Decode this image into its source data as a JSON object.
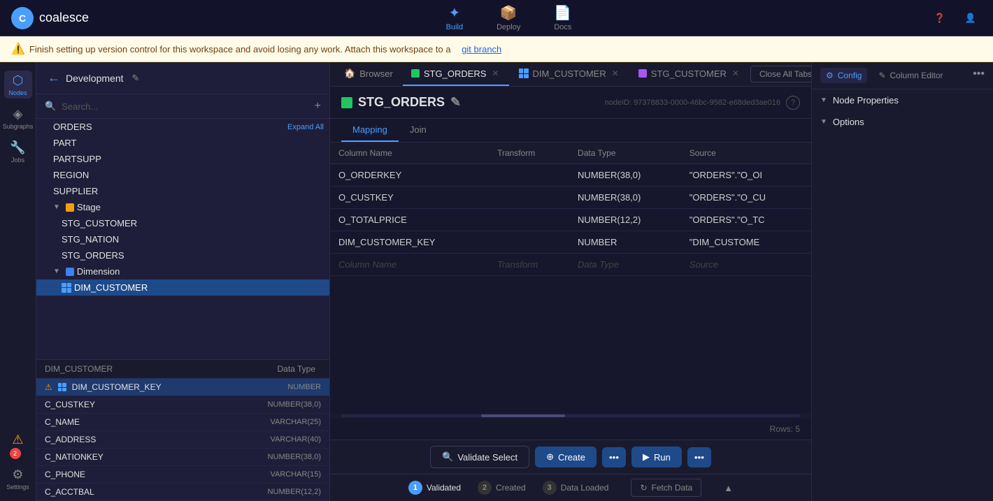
{
  "app": {
    "logo_text": "coalesce",
    "logo_abbr": "C"
  },
  "top_nav": {
    "tabs": [
      {
        "id": "build",
        "label": "Build",
        "icon": "✦",
        "active": true
      },
      {
        "id": "deploy",
        "label": "Deploy",
        "icon": "📦",
        "active": false
      },
      {
        "id": "docs",
        "label": "Docs",
        "icon": "📄",
        "active": false
      }
    ]
  },
  "warning_banner": {
    "text": "Finish setting up version control for this workspace and avoid losing any work. Attach this workspace to a",
    "link_text": "git branch"
  },
  "sidebar": {
    "title": "Development",
    "search_placeholder": "Search...",
    "tree": {
      "root_items": [
        {
          "name": "ORDERS",
          "indent": 2
        },
        {
          "name": "PART",
          "indent": 2
        },
        {
          "name": "PARTSUPP",
          "indent": 2
        },
        {
          "name": "REGION",
          "indent": 2
        },
        {
          "name": "SUPPLIER",
          "indent": 2
        },
        {
          "name": "Stage",
          "indent": 1,
          "folder": true,
          "expanded": true
        },
        {
          "name": "STG_CUSTOMER",
          "indent": 2
        },
        {
          "name": "STG_NATION",
          "indent": 2
        },
        {
          "name": "STG_ORDERS",
          "indent": 2
        },
        {
          "name": "Dimension",
          "indent": 1,
          "folder": true,
          "expanded": true
        },
        {
          "name": "DIM_CUSTOMER",
          "indent": 2,
          "selected": true
        }
      ]
    },
    "bottom_panel": {
      "headers": [
        "DIM_CUSTOMER",
        "Data Type"
      ],
      "rows": [
        {
          "name": "DIM_CUSTOMER_KEY",
          "type": "NUMBER",
          "selected": true,
          "warning": true
        },
        {
          "name": "C_CUSTKEY",
          "type": "NUMBER(38,0)",
          "selected": false
        },
        {
          "name": "C_NAME",
          "type": "VARCHAR(25)",
          "selected": false
        },
        {
          "name": "C_ADDRESS",
          "type": "VARCHAR(40)",
          "selected": false
        },
        {
          "name": "C_NATIONKEY",
          "type": "NUMBER(38,0)",
          "selected": false
        },
        {
          "name": "C_PHONE",
          "type": "VARCHAR(15)",
          "selected": false
        },
        {
          "name": "C_ACCTBAL",
          "type": "NUMBER(12,2)",
          "selected": false
        }
      ],
      "warning_count": "2"
    }
  },
  "icon_nav": {
    "items": [
      {
        "id": "nodes",
        "label": "Nodes",
        "icon": "⬡",
        "active": true
      },
      {
        "id": "subgraphs",
        "label": "Subgraphs",
        "icon": "◈",
        "active": false
      },
      {
        "id": "jobs",
        "label": "Jobs",
        "icon": "🔧",
        "active": false
      },
      {
        "id": "settings",
        "label": "Settings",
        "icon": "⚙",
        "active": false
      }
    ],
    "warning_count": "2"
  },
  "tabs_bar": {
    "tabs": [
      {
        "id": "browser",
        "label": "Browser",
        "icon": "🏠",
        "closable": false,
        "active": false
      },
      {
        "id": "stg_orders",
        "label": "STG_ORDERS",
        "icon": "green",
        "closable": true,
        "active": true
      },
      {
        "id": "dim_customer",
        "label": "DIM_CUSTOMER",
        "icon": "blue",
        "closable": true,
        "active": false
      },
      {
        "id": "stg_customer",
        "label": "STG_CUSTOMER",
        "icon": "purple",
        "closable": true,
        "active": false
      }
    ],
    "close_all_label": "Close All Tabs"
  },
  "node_header": {
    "title": "STG_ORDERS",
    "node_id": "nodeID: 97378833-0000-46bc-9582-e68ded3ae016"
  },
  "sub_tabs": [
    {
      "id": "mapping",
      "label": "Mapping",
      "active": true
    },
    {
      "id": "join",
      "label": "Join",
      "active": false
    }
  ],
  "table": {
    "columns": [
      "Column Name",
      "Transform",
      "Data Type",
      "Source"
    ],
    "rows": [
      {
        "column_name": "O_ORDERKEY",
        "transform": "",
        "data_type": "NUMBER(38,0)",
        "source": "\"ORDERS\".\"O_OI"
      },
      {
        "column_name": "O_CUSTKEY",
        "transform": "",
        "data_type": "NUMBER(38,0)",
        "source": "\"ORDERS\".\"O_CU"
      },
      {
        "column_name": "O_TOTALPRICE",
        "transform": "",
        "data_type": "NUMBER(12,2)",
        "source": "\"ORDERS\".\"O_TC"
      },
      {
        "column_name": "DIM_CUSTOMER_KEY",
        "transform": "",
        "data_type": "NUMBER",
        "source": "\"DIM_CUSTOME"
      }
    ],
    "empty_row": {
      "column_name": "Column Name",
      "transform": "Transform",
      "data_type": "Data Type",
      "source": "Source"
    },
    "rows_count": "Rows: 5"
  },
  "bottom_toolbar": {
    "validate_label": "Validate Select",
    "create_label": "Create",
    "run_label": "Run"
  },
  "status_bar": {
    "steps": [
      {
        "num": "1",
        "label": "Validated",
        "active": true
      },
      {
        "num": "2",
        "label": "Created",
        "active": false
      },
      {
        "num": "3",
        "label": "Data Loaded",
        "active": false
      }
    ],
    "fetch_label": "Fetch Data"
  },
  "right_panel": {
    "tabs": [
      {
        "id": "config",
        "label": "Config",
        "icon": "⚙",
        "active": true
      },
      {
        "id": "column_editor",
        "label": "Column Editor",
        "icon": "✎",
        "active": false
      }
    ],
    "sections": [
      {
        "id": "node_properties",
        "label": "Node Properties"
      },
      {
        "id": "options",
        "label": "Options"
      }
    ]
  }
}
